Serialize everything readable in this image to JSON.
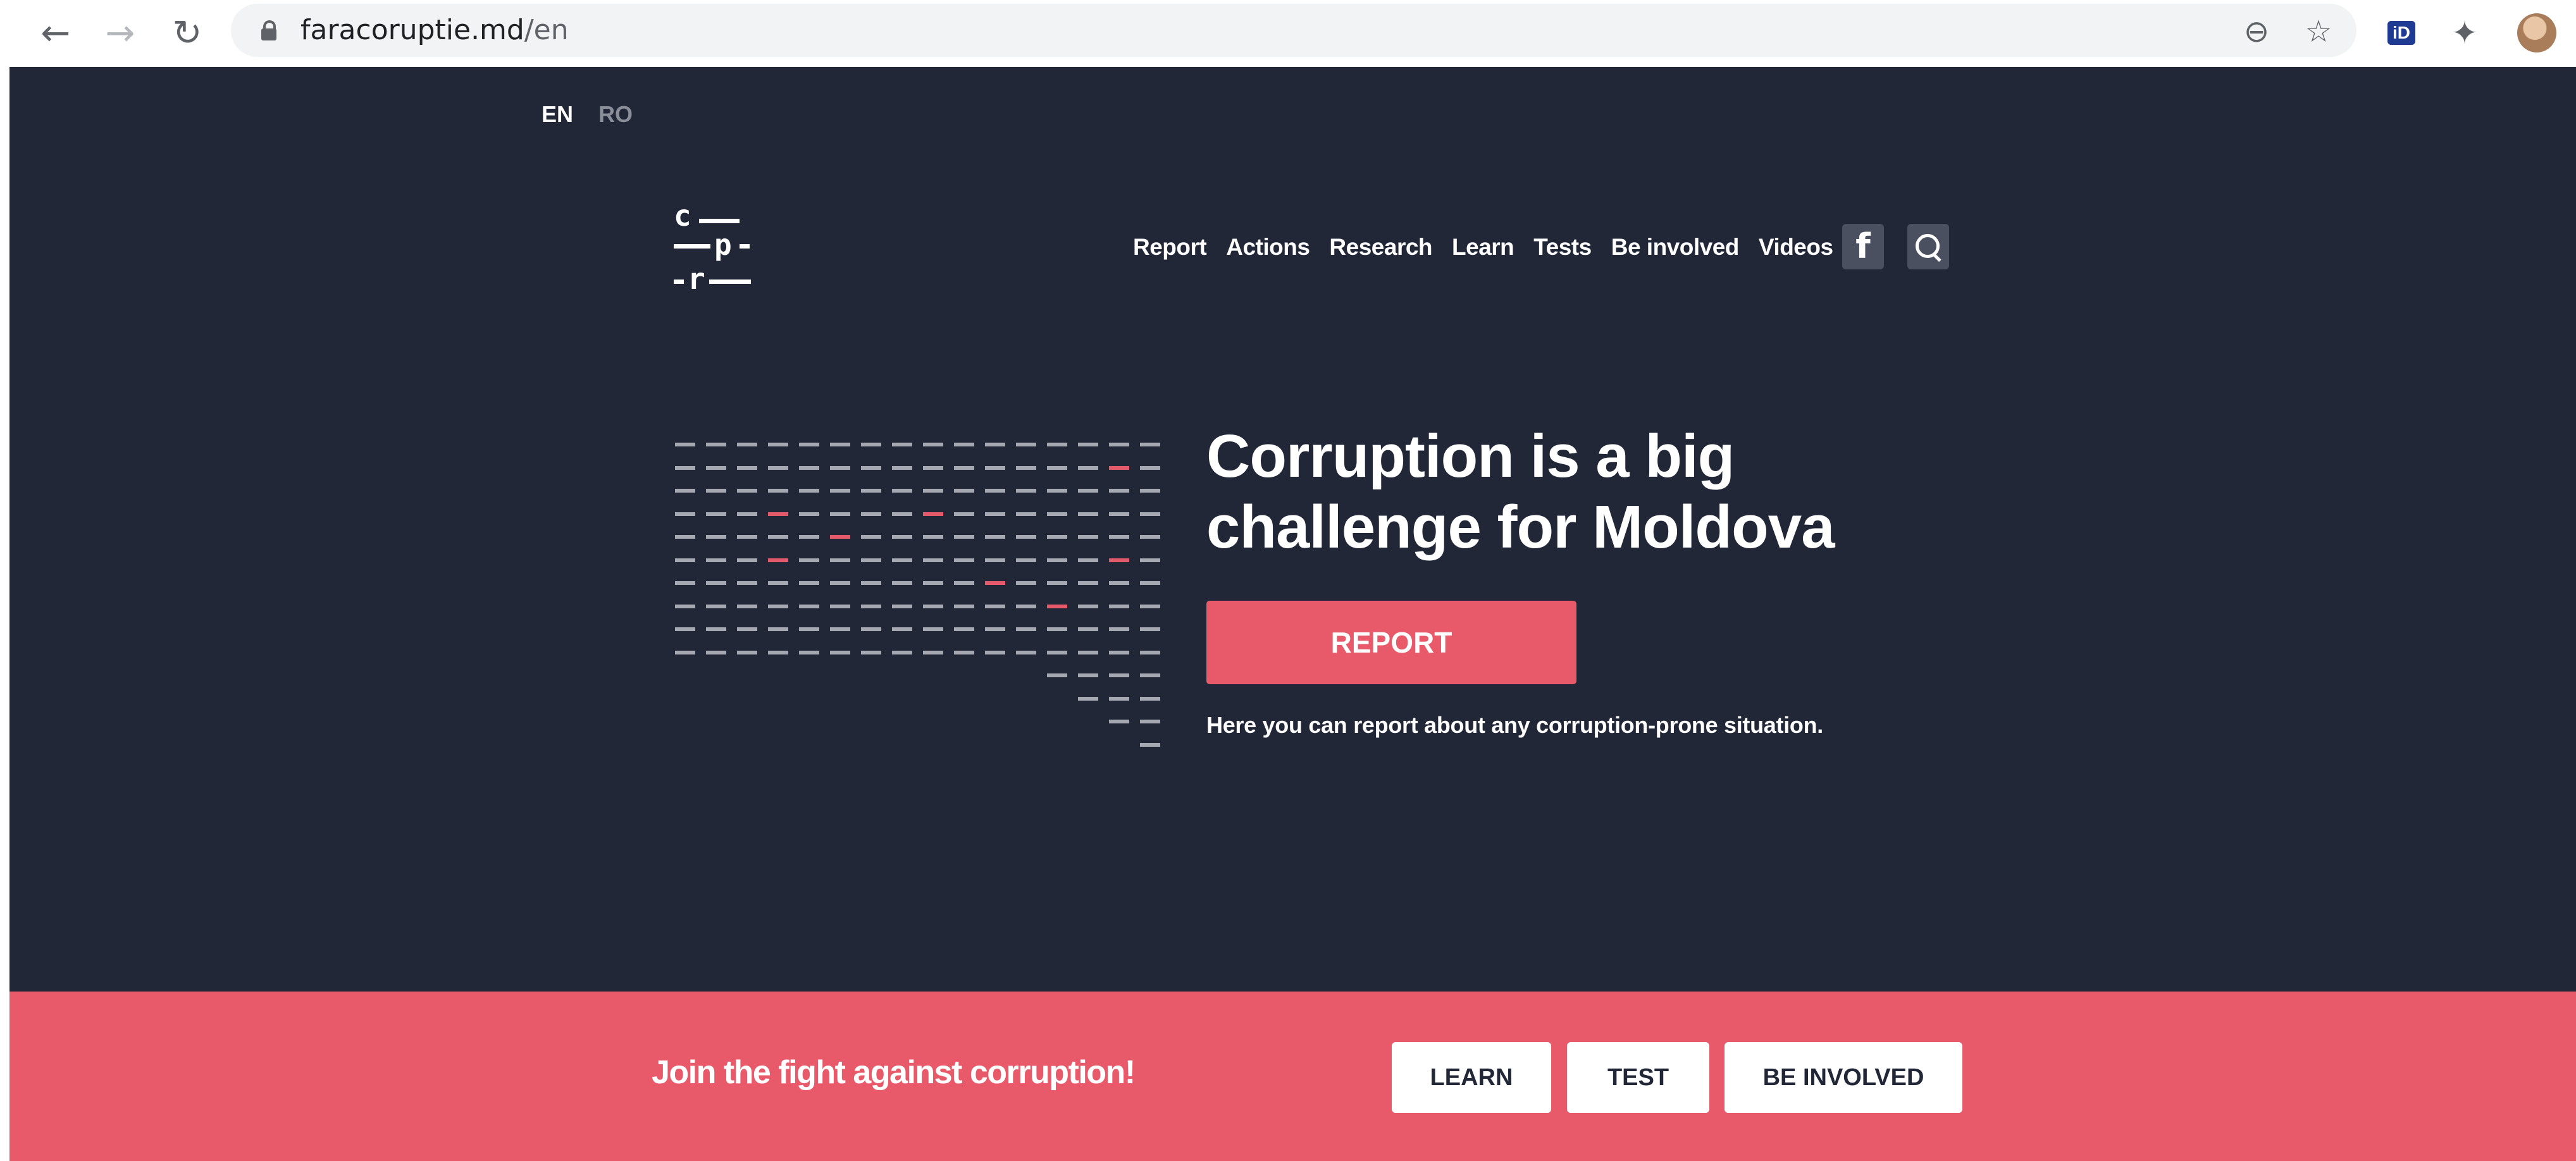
{
  "browser": {
    "back_icon": "←",
    "forward_icon": "→",
    "reload_icon": "↻",
    "url_domain": "faracoruptie.md",
    "url_path": "/en",
    "zoom_icon": "⊖",
    "star_icon": "☆",
    "id_extension_label": "iD",
    "puzzle_icon": "✦"
  },
  "languages": [
    {
      "code": "EN",
      "active": true
    },
    {
      "code": "RO",
      "active": false
    }
  ],
  "logo": {
    "line1": "c",
    "line2": "p",
    "line3": "r"
  },
  "nav": {
    "items": [
      "Report",
      "Actions",
      "Research",
      "Learn",
      "Tests",
      "Be involved",
      "Videos"
    ],
    "facebook_label": "f"
  },
  "hero": {
    "headline": "Corruption is a big challenge for Moldova",
    "report_button": "REPORT",
    "report_subtext": "Here you can report about any corruption-prone situation."
  },
  "banner": {
    "text": "Join the fight against corruption!",
    "buttons": [
      "LEARN",
      "TEST",
      "BE INVOLVED"
    ]
  },
  "colors": {
    "page_bg": "#212737",
    "accent": "#e8596a",
    "dash_grey": "#a5a8b0",
    "dash_red": "#e45a6b"
  }
}
